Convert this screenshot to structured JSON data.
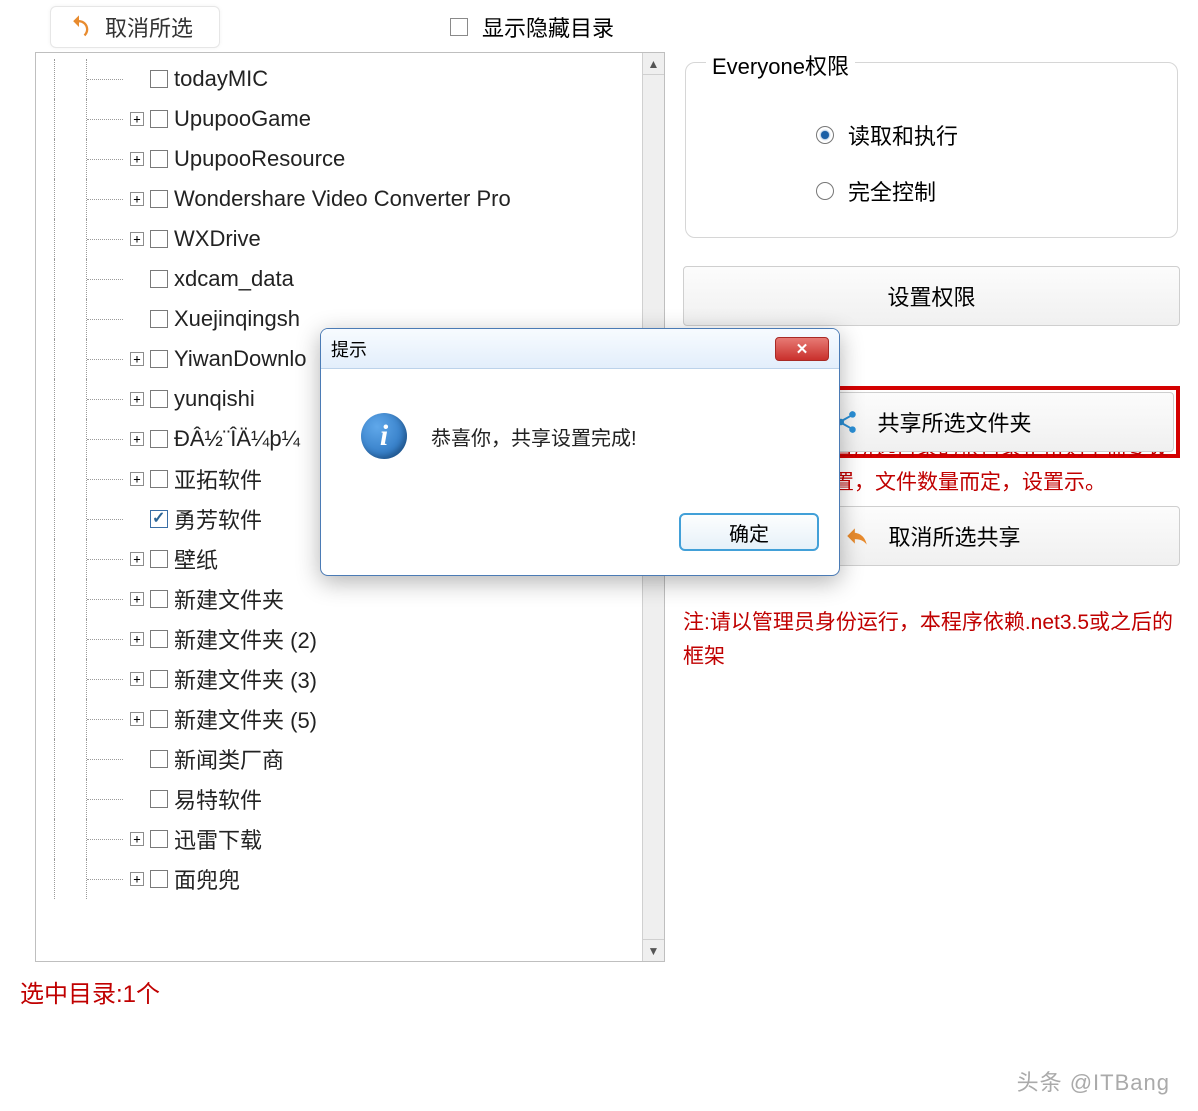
{
  "toolbar": {
    "cancel_selection": "取消所选",
    "show_hidden": "显示隐藏目录"
  },
  "tree": {
    "items": [
      {
        "label": "todayMIC",
        "expand": "",
        "checked": false
      },
      {
        "label": "UpupooGame",
        "expand": "+",
        "checked": false
      },
      {
        "label": "UpupooResource",
        "expand": "+",
        "checked": false
      },
      {
        "label": "Wondershare Video Converter Pro",
        "expand": "+",
        "checked": false
      },
      {
        "label": "WXDrive",
        "expand": "+",
        "checked": false
      },
      {
        "label": "xdcam_data",
        "expand": "",
        "checked": false
      },
      {
        "label": "Xuejinqingsh",
        "expand": "",
        "checked": false
      },
      {
        "label": "YiwanDownlo",
        "expand": "+",
        "checked": false
      },
      {
        "label": "yunqishi",
        "expand": "+",
        "checked": false
      },
      {
        "label": "ÐÂ½¨ÎÄ¼þ¼",
        "expand": "+",
        "checked": false
      },
      {
        "label": "亚拓软件",
        "expand": "+",
        "checked": false
      },
      {
        "label": "勇芳软件",
        "expand": "",
        "checked": true
      },
      {
        "label": "壁纸",
        "expand": "+",
        "checked": false
      },
      {
        "label": "新建文件夹",
        "expand": "+",
        "checked": false
      },
      {
        "label": "新建文件夹 (2)",
        "expand": "+",
        "checked": false
      },
      {
        "label": "新建文件夹 (3)",
        "expand": "+",
        "checked": false
      },
      {
        "label": "新建文件夹 (5)",
        "expand": "+",
        "checked": false
      },
      {
        "label": "新闻类厂商",
        "expand": "",
        "checked": false
      },
      {
        "label": "易特软件",
        "expand": "",
        "checked": false
      },
      {
        "label": "迅雷下载",
        "expand": "+",
        "checked": false
      },
      {
        "label": "面兜兜",
        "expand": "+",
        "checked": false
      }
    ]
  },
  "permissions": {
    "group_title": "Everyone权限",
    "read_execute": "读取和执行",
    "full_control": "完全控制",
    "selected": "read_execute",
    "set_button": "设置权限"
  },
  "info_red_partial": "置所选目录的根目录正常则不需要设置，文件数量而定，设置示。",
  "buttons": {
    "share": "共享所选文件夹",
    "unshare": "取消所选共享"
  },
  "note_red": "注:请以管理员身份运行，本程序依赖.net3.5或之后的框架",
  "status_bar": "选中目录:1个",
  "watermark": "头条 @ITBang",
  "dialog": {
    "title": "提示",
    "message": "恭喜你，共享设置完成!",
    "ok": "确定"
  }
}
